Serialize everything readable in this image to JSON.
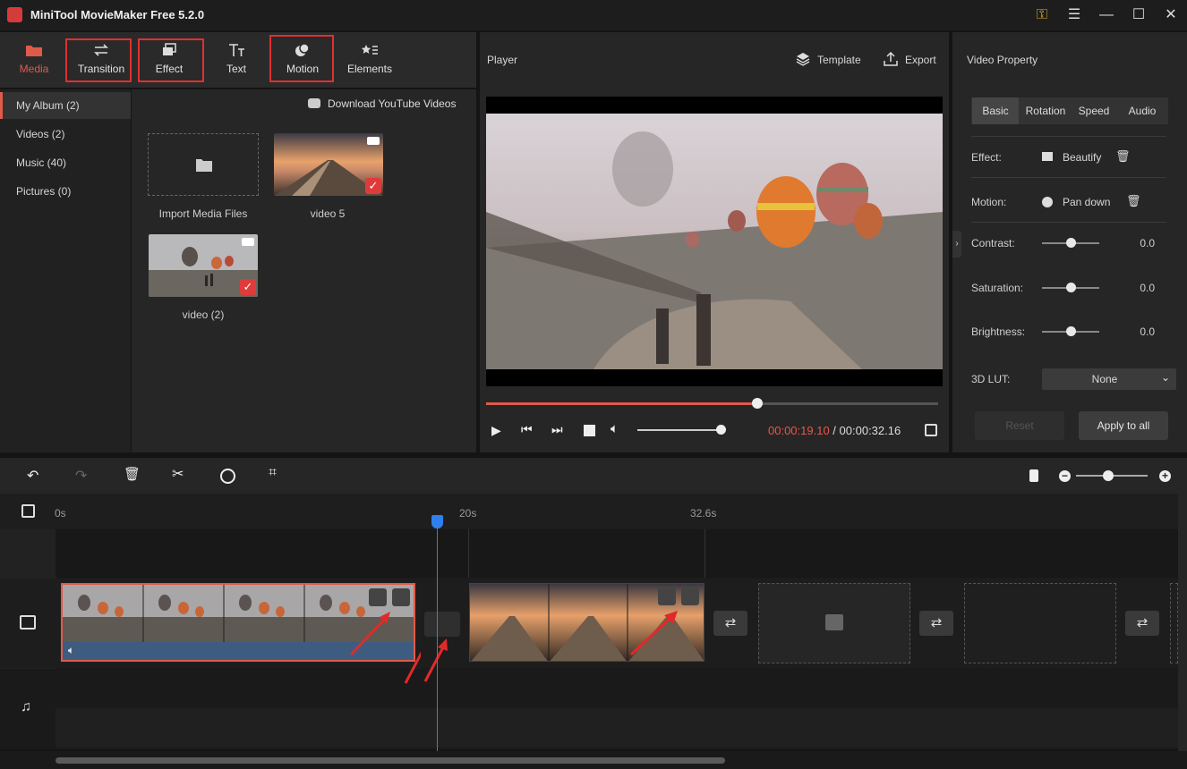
{
  "app": {
    "title": "MiniTool MovieMaker Free 5.2.0"
  },
  "toolbar": {
    "media": "Media",
    "transition": "Transition",
    "effect": "Effect",
    "text": "Text",
    "motion": "Motion",
    "elements": "Elements"
  },
  "sidebar": {
    "items": [
      {
        "label": "My Album (2)"
      },
      {
        "label": "Videos (2)"
      },
      {
        "label": "Music (40)"
      },
      {
        "label": "Pictures (0)"
      }
    ]
  },
  "media": {
    "download": "Download YouTube Videos",
    "import": "Import Media Files",
    "items": [
      {
        "label": "video 5"
      },
      {
        "label": "video (2)"
      }
    ]
  },
  "player": {
    "title": "Player",
    "template": "Template",
    "export": "Export",
    "current_time": "00:00:19.10",
    "separator": " / ",
    "total_time": "00:00:32.16",
    "progress": 0.6
  },
  "props": {
    "title": "Video Property",
    "tabs": [
      "Basic",
      "Rotation",
      "Speed",
      "Audio"
    ],
    "effect_label": "Effect:",
    "effect_value": "Beautify",
    "motion_label": "Motion:",
    "motion_value": "Pan down",
    "contrast_label": "Contrast:",
    "contrast_value": "0.0",
    "saturation_label": "Saturation:",
    "saturation_value": "0.0",
    "brightness_label": "Brightness:",
    "brightness_value": "0.0",
    "lut_label": "3D LUT:",
    "lut_value": "None",
    "reset": "Reset",
    "apply": "Apply to all"
  },
  "timeline": {
    "ruler": [
      "0s",
      "20s",
      "32.6s"
    ]
  },
  "colors": {
    "accent": "#e05a4a",
    "highlight": "#e03030",
    "playhead": "#2f80ed"
  }
}
